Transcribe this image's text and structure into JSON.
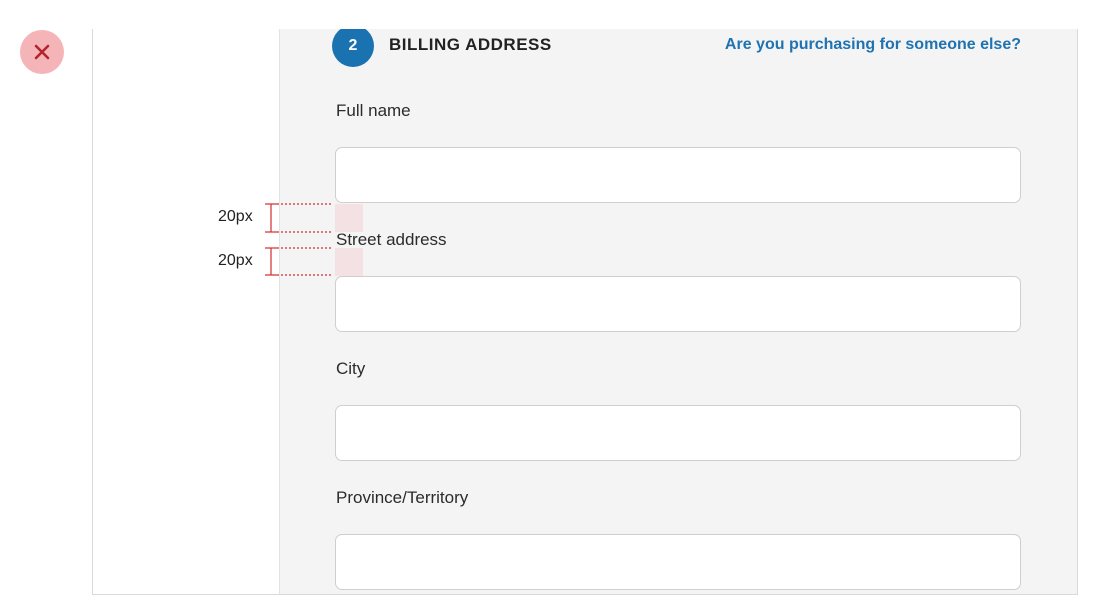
{
  "marker": {
    "icon": "close-icon",
    "color": "#f5b5b8",
    "glyph_color": "#b3262d"
  },
  "header": {
    "step_number": "2",
    "title": "BILLING ADDRESS",
    "link": "Are you purchasing for someone else?"
  },
  "fields": [
    {
      "label": "Full name",
      "value": ""
    },
    {
      "label": "Street address",
      "value": ""
    },
    {
      "label": "City",
      "value": ""
    },
    {
      "label": "Province/Territory",
      "value": ""
    }
  ],
  "annotation": {
    "spacing_above_label": "20px",
    "spacing_below_label": "20px",
    "color": "#d42a2a"
  },
  "colors": {
    "accent": "#1b72b0",
    "link": "#1f73b1",
    "panel_background": "#f4f4f4"
  }
}
